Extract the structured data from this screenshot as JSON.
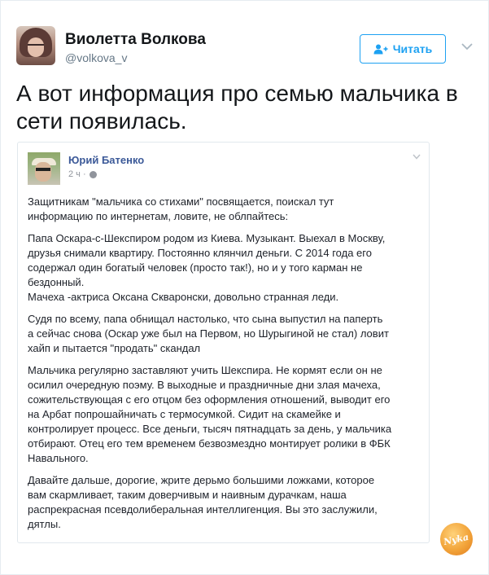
{
  "tweet": {
    "author_name": "Виолетта Волкова",
    "author_handle": "@volkova_v",
    "follow_label": "Читать",
    "text": "А вот информация про семью мальчика в сети появилась."
  },
  "embedded_post": {
    "author_name": "Юрий Батенко",
    "time": "2 ч ·",
    "paragraphs": [
      [
        "Защитникам \"мальчика со стихами\" посвящается, поискал тут",
        "информацию по интернетам, ловите, не облпайтесь:"
      ],
      [
        "Папа Оскара-с-Шекспиром родом из Киева. Музыкант. Выехал в Москву,",
        "друзья снимали квартиру. Постоянно клянчил деньги. С 2014 года его",
        "содержал один богатый человек (просто так!), но и у того карман не",
        "бездонный.",
        "Мачеха -актриса Оксана Скваронски, довольно странная леди."
      ],
      [
        "Судя по всему, папа обнищал настолько, что сына выпустил на паперть",
        "а сейчас снова (Оскар уже был на Первом, но Шурыгиной не стал) ловит",
        "хайп и пытается \"продать\" скандал"
      ],
      [
        "Мальчика регулярно заставляют учить Шекспира. Не кормят если он не",
        "осилил очередную поэму. В выходные и праздничные дни злая мачеха,",
        "сожительствующая с его отцом без оформления отношений, выводит его",
        "на Арбат попрошайничать с термосумкой. Сидит на скамейке и",
        "контролирует процесс. Все деньги, тысяч пятнадцать за день, у мальчика",
        "отбирают. Отец его тем временем безвозмездно монтирует ролики в ФБК",
        "Навального."
      ],
      [
        "Давайте дальше, дорогие, жрите дерьмо большими ложками, которое",
        "вам скармливает, таким доверчивым и наивным дурачкам, наша",
        "распрекрасная псевдолиберальная интеллигенция. Вы это заслужили,",
        "дятлы."
      ]
    ]
  },
  "watermark_text": "Nyka",
  "colors": {
    "accent": "#1da1f2",
    "fb_name": "#3b5998",
    "muted": "#657786"
  }
}
